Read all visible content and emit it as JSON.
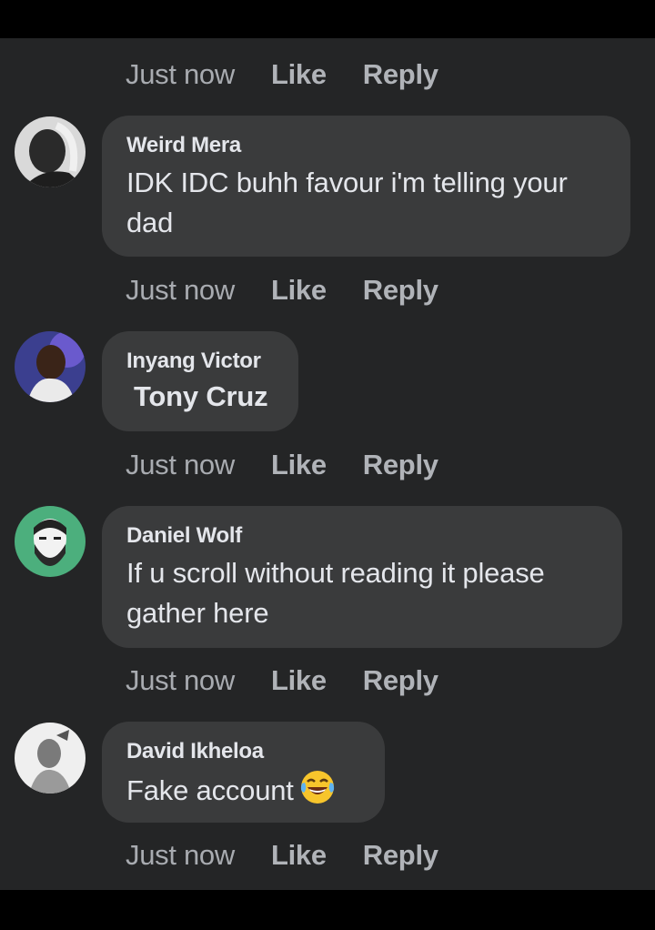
{
  "action_labels": {
    "time": "Just now",
    "like": "Like",
    "reply": "Reply"
  },
  "comments": [
    {
      "author": "Weird Mera",
      "text": "IDK IDC buhh favour i'm telling your dad"
    },
    {
      "author": "Inyang Victor",
      "text": "Tony Cruz"
    },
    {
      "author": "Daniel Wolf",
      "text": "If u scroll without reading it please gather here"
    },
    {
      "author": "David Ikheloa",
      "text": "Fake account",
      "emoji": "tears-of-joy-emoji"
    }
  ],
  "colors": {
    "background": "#242526",
    "bubble": "#3a3b3c",
    "primary_text": "#e4e6eb",
    "secondary_text": "#b0b3b8"
  }
}
